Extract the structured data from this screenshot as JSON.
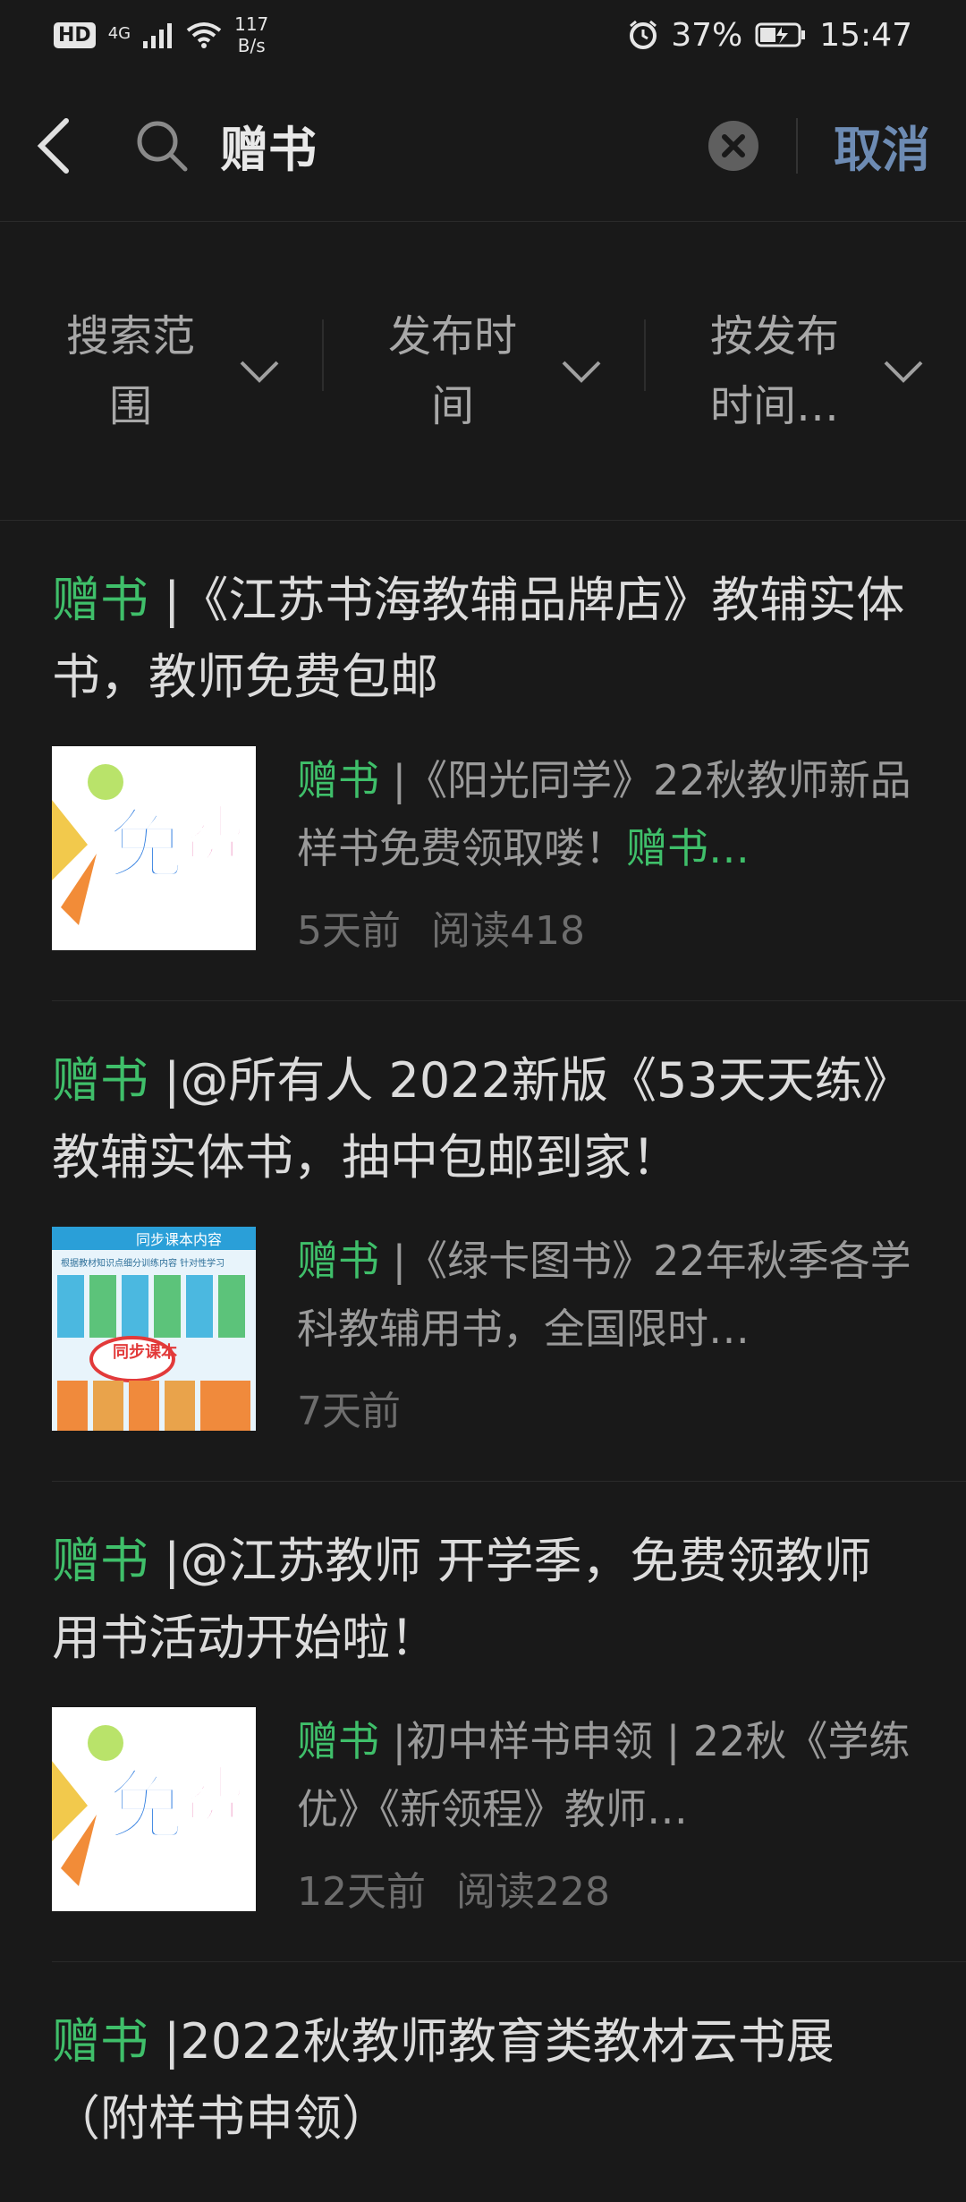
{
  "status": {
    "hd": "HD",
    "network": "4G",
    "speed_value": "117",
    "speed_unit": "B/s",
    "battery": "37%",
    "time": "15:47",
    "icons": [
      "signal-icon",
      "wifi-icon",
      "alarm-icon",
      "battery-icon"
    ]
  },
  "search": {
    "query": "赠书",
    "cancel_label": "取消"
  },
  "filters": [
    {
      "line1": "搜索范",
      "line2": "围"
    },
    {
      "line1": "发布时",
      "line2": "间"
    },
    {
      "line1": "按发布",
      "line2": "时间…"
    }
  ],
  "results": [
    {
      "title_hl": "赠书",
      "title_rest": " |《江苏书海教辅品牌店》教辅实体书，教师免费包邮",
      "excerpt_hl": "赠书",
      "excerpt_rest": " |《阳光同学》22秋教师新品样书免费领取喽！",
      "excerpt_tail_hl": "赠书…",
      "time": "5天前",
      "reads": "阅读418",
      "thumb_text": "免费"
    },
    {
      "title_hl": "赠书",
      "title_rest": " |@所有人 2022新版《53天天练》教辅实体书，抽中包邮到家！",
      "excerpt_hl": "赠书",
      "excerpt_rest": " |《绿卡图书》22年秋季各学科教辅用书，全国限时…",
      "excerpt_tail_hl": "",
      "time": "7天前",
      "reads": "",
      "thumb_caption": "同步课本内容",
      "thumb_sub": "根据教材知识点细分训练内容 针对性学习",
      "thumb_tag": "同步课本"
    },
    {
      "title_hl": "赠书",
      "title_rest": " |@江苏教师 开学季，免费领教师用书活动开始啦！",
      "excerpt_hl": "赠书",
      "excerpt_rest": " |初中样书申领 | 22秋《学练优》《新领程》教师…",
      "excerpt_tail_hl": "",
      "time": "12天前",
      "reads": "阅读228",
      "thumb_text": "免费"
    },
    {
      "title_hl": "赠书",
      "title_rest": " |2022秋教师教育类教材云书展（附样书申领）"
    }
  ],
  "colors": {
    "highlight": "#3fbf6a",
    "cancel": "#6d8bb3",
    "background": "#191919"
  }
}
